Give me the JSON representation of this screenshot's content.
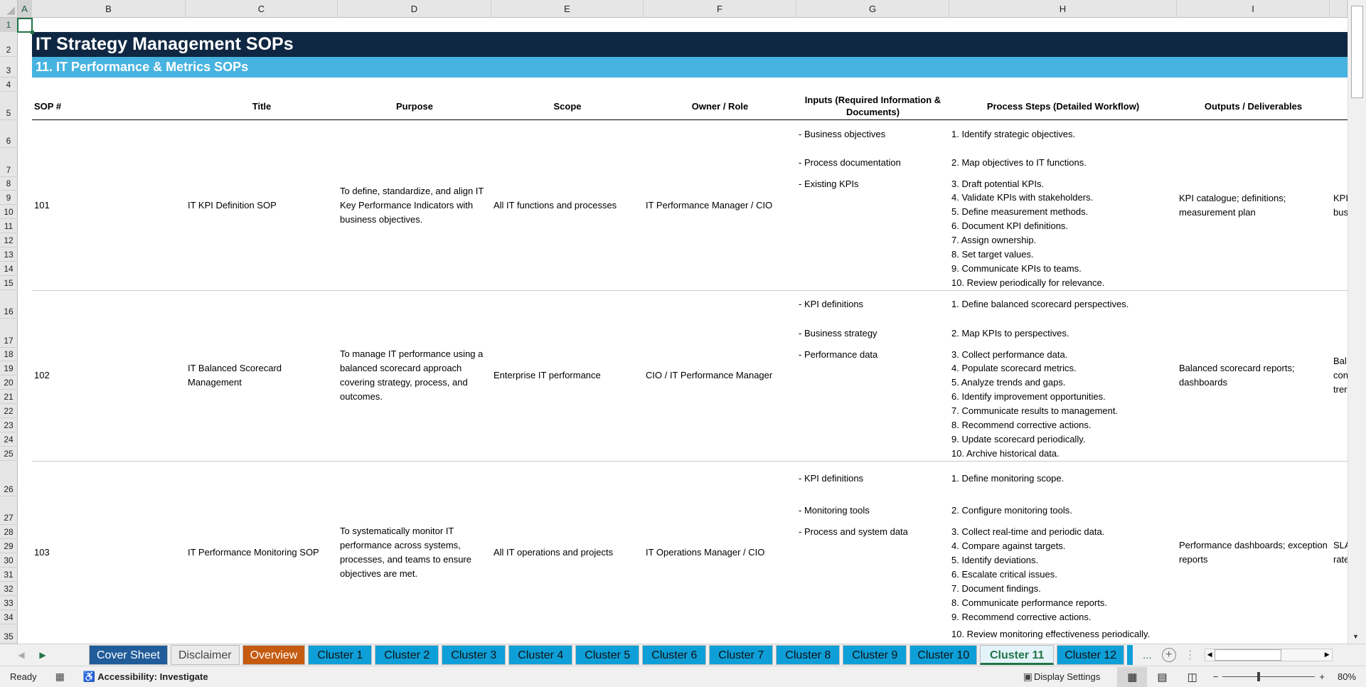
{
  "columns": [
    "A",
    "B",
    "C",
    "D",
    "E",
    "F",
    "G",
    "H",
    "I",
    ""
  ],
  "title": "IT Strategy Management SOPs",
  "subtitle": "11. IT Performance & Metrics SOPs",
  "headers": {
    "sop": "SOP #",
    "title": "Title",
    "purpose": "Purpose",
    "scope": "Scope",
    "owner": "Owner / Role",
    "inputs": "Inputs (Required Information & Documents)",
    "steps": "Process Steps (Detailed Workflow)",
    "outputs": "Outputs / Deliverables"
  },
  "sops": [
    {
      "sop": "101",
      "title": "IT KPI Definition SOP",
      "purpose": "To define, standardize, and align IT Key Performance Indicators with business objectives.",
      "scope": "All IT functions and processes",
      "owner": "IT Performance Manager / CIO",
      "inputs": [
        "- Business objectives",
        "- Process documentation",
        "- Existing KPIs"
      ],
      "steps": [
        "1. Identify strategic objectives.",
        "2. Map objectives to IT functions.",
        "3. Draft potential KPIs.",
        "4. Validate KPIs with stakeholders.",
        "5. Define measurement methods.",
        "6. Document KPI definitions.",
        "7. Assign ownership.",
        "8. Set target values.",
        "9. Communicate KPIs to teams.",
        "10. Review periodically for relevance."
      ],
      "outputs": "KPI catalogue; definitions; measurement plan",
      "next_col": [
        "KPI",
        "bus"
      ]
    },
    {
      "sop": "102",
      "title": "IT Balanced Scorecard Management",
      "purpose": "To manage IT performance using a balanced scorecard approach covering strategy, process, and outcomes.",
      "scope": "Enterprise IT performance",
      "owner": "CIO / IT Performance Manager",
      "inputs": [
        "- KPI definitions",
        "- Business strategy",
        "- Performance data"
      ],
      "steps": [
        "1. Define balanced scorecard perspectives.",
        "2. Map KPIs to perspectives.",
        "3. Collect performance data.",
        "4. Populate scorecard metrics.",
        "5. Analyze trends and gaps.",
        "6. Identify improvement opportunities.",
        "7. Communicate results to management.",
        "8. Recommend corrective actions.",
        "9. Update scorecard periodically.",
        "10. Archive historical data."
      ],
      "outputs": "Balanced scorecard reports; dashboards",
      "next_col": [
        "Bal",
        "con",
        "trer"
      ]
    },
    {
      "sop": "103",
      "title": "IT Performance Monitoring SOP",
      "purpose": "To systematically monitor IT performance across systems, processes, and teams to ensure objectives are met.",
      "scope": "All IT operations and projects",
      "owner": "IT Operations Manager / CIO",
      "inputs": [
        "- KPI definitions",
        "- Monitoring tools",
        "- Process and system data"
      ],
      "steps": [
        "1. Define monitoring scope.",
        "2. Configure monitoring tools.",
        "3. Collect real-time and periodic data.",
        "4. Compare against targets.",
        "5. Identify deviations.",
        "6. Escalate critical issues.",
        "7. Document findings.",
        "8. Communicate performance reports.",
        "9. Recommend corrective actions.",
        "10. Review monitoring effectiveness periodically."
      ],
      "outputs": "Performance dashboards; exception reports",
      "next_col": [
        "SLA",
        "rate"
      ]
    }
  ],
  "tabs": [
    {
      "label": "Cover Sheet",
      "bg": "#1f5c99",
      "fg": "#ffffff"
    },
    {
      "label": "Disclaimer",
      "bg": "#ebebeb",
      "fg": "#444444"
    },
    {
      "label": "Overview",
      "bg": "#c55a11",
      "fg": "#ffffff"
    },
    {
      "label": "Cluster 1",
      "bg": "#0e9fd8",
      "fg": "#111111"
    },
    {
      "label": "Cluster 2",
      "bg": "#0e9fd8",
      "fg": "#111111"
    },
    {
      "label": "Cluster 3",
      "bg": "#0e9fd8",
      "fg": "#111111"
    },
    {
      "label": "Cluster 4",
      "bg": "#0e9fd8",
      "fg": "#111111"
    },
    {
      "label": "Cluster 5",
      "bg": "#0e9fd8",
      "fg": "#111111"
    },
    {
      "label": "Cluster 6",
      "bg": "#0e9fd8",
      "fg": "#111111"
    },
    {
      "label": "Cluster 7",
      "bg": "#0e9fd8",
      "fg": "#111111"
    },
    {
      "label": "Cluster 8",
      "bg": "#0e9fd8",
      "fg": "#111111"
    },
    {
      "label": "Cluster 9",
      "bg": "#0e9fd8",
      "fg": "#111111"
    },
    {
      "label": "Cluster 10",
      "bg": "#0e9fd8",
      "fg": "#111111"
    },
    {
      "label": "Cluster 11",
      "bg": "#e4f3fa",
      "fg": "#217346",
      "active": true
    },
    {
      "label": "Cluster 12",
      "bg": "#0e9fd8",
      "fg": "#111111"
    }
  ],
  "tab_more": "...",
  "status": {
    "ready": "Ready",
    "accessibility": "Accessibility: Investigate",
    "display_settings": "Display Settings",
    "zoom": "80%"
  }
}
